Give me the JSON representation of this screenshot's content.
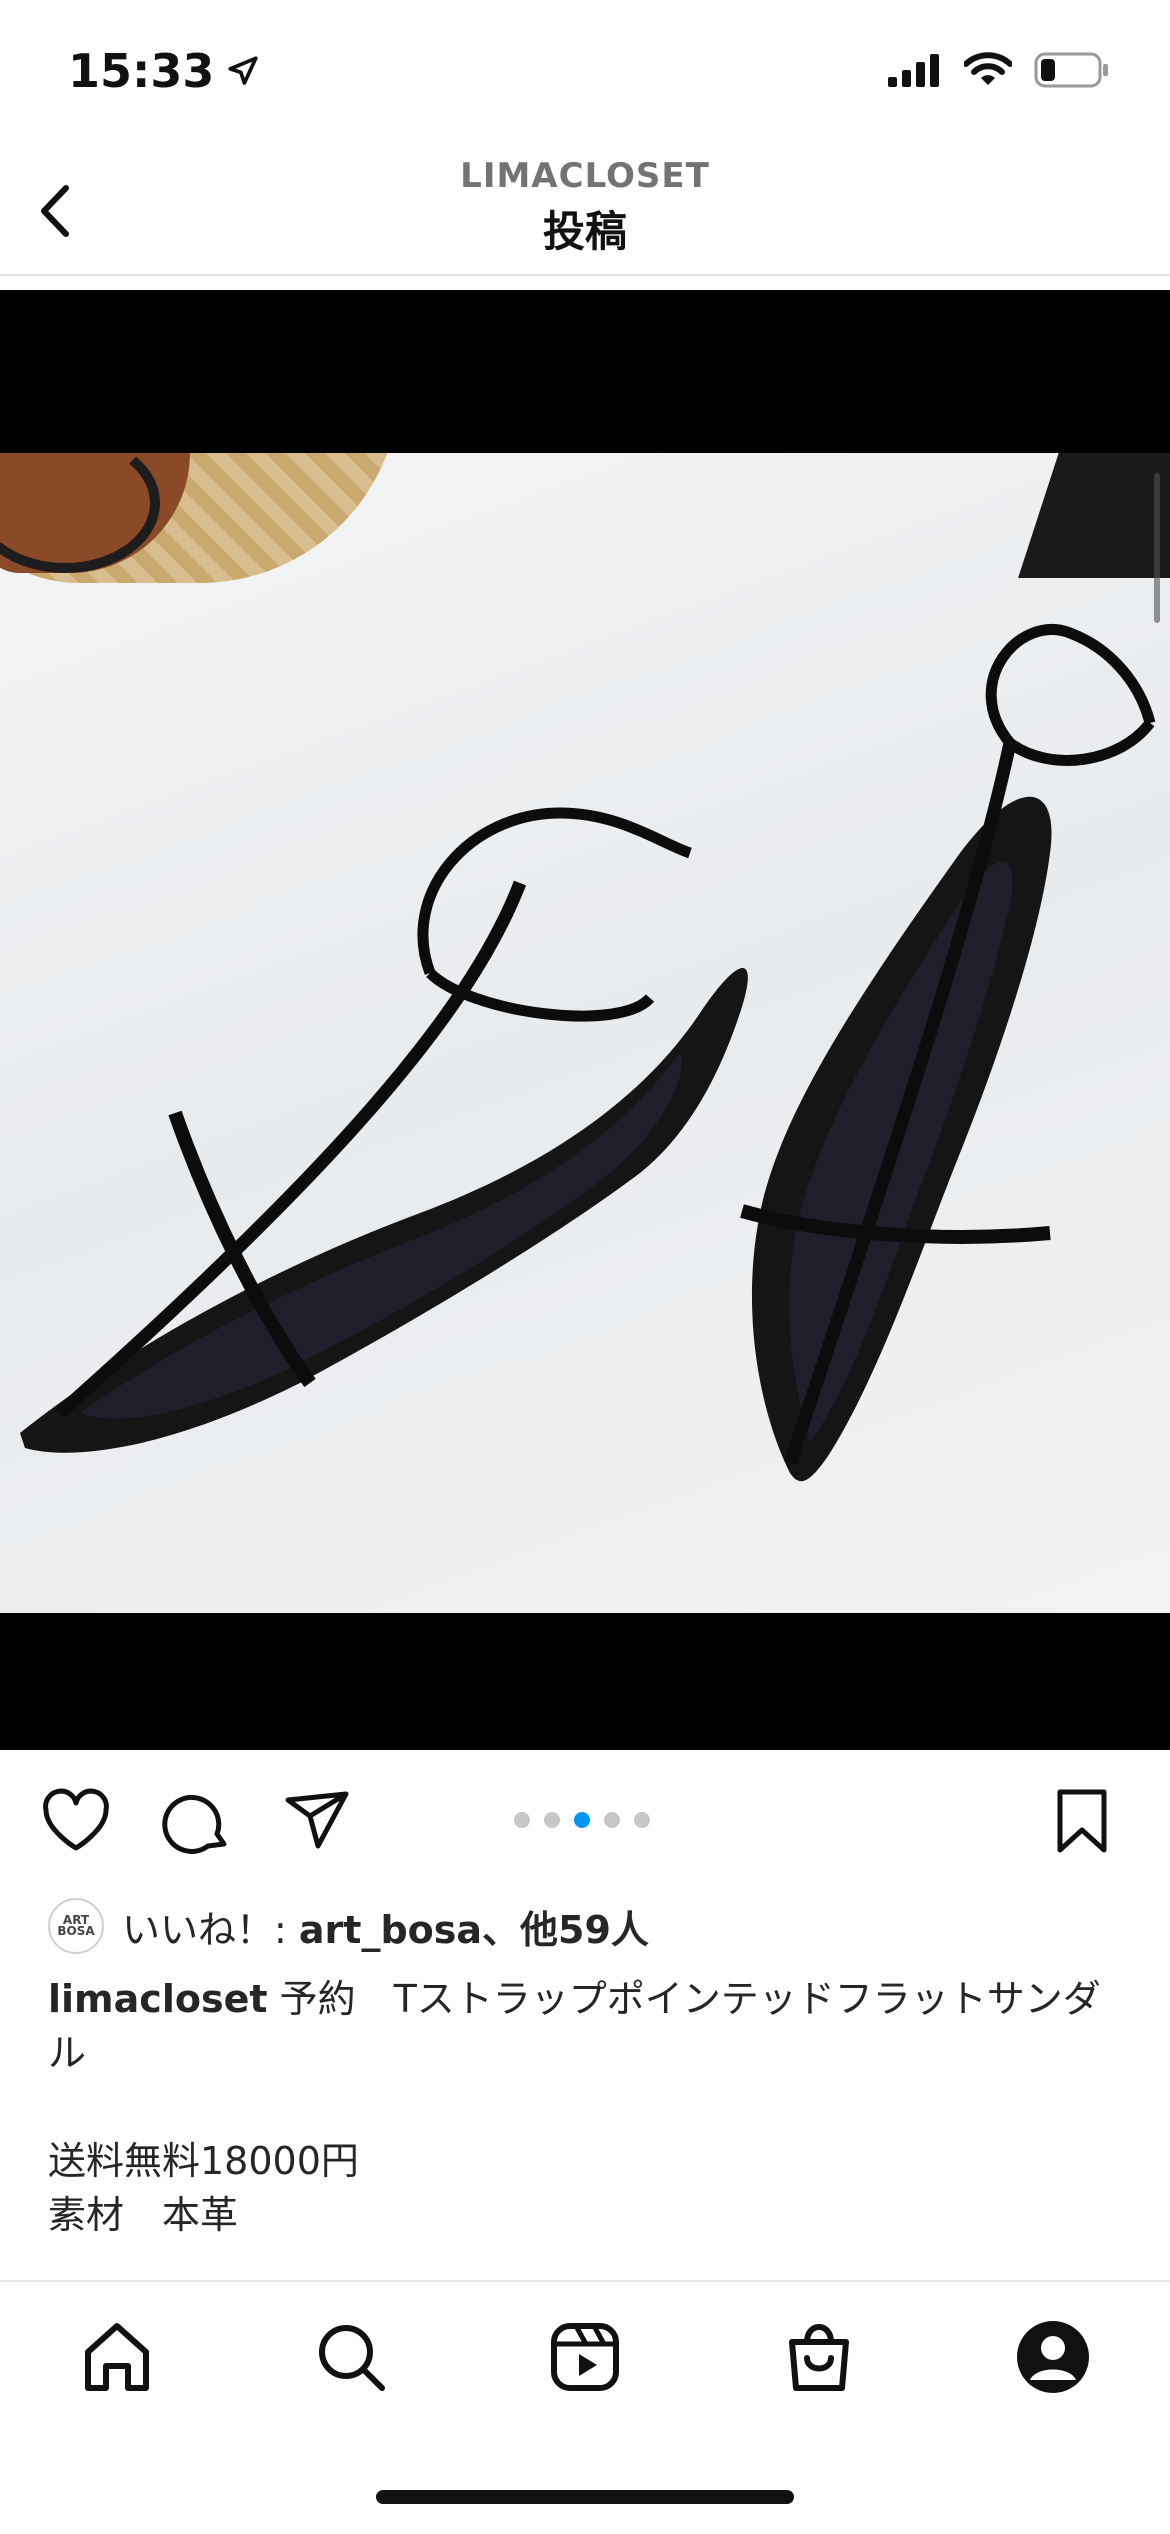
{
  "status": {
    "time": "15:33"
  },
  "nav": {
    "account": "LIMACLOSET",
    "title": "投稿"
  },
  "media": {
    "dot_count": 5,
    "active_dot": 2
  },
  "likes": {
    "prefix": "いいね！: ",
    "user": "art_bosa",
    "suffix": "、他59人",
    "avatar_text": "ART BOSA"
  },
  "caption": {
    "username": "limacloset",
    "line1": " 予約　Tストラップポインテッドフラットサンダル",
    "line2": "送料無料18000円",
    "line3": "素材　本革"
  },
  "colors": {
    "accent": "#0095f6",
    "text": "#262626",
    "muted": "#737373"
  },
  "icons": {
    "actions": [
      "heart-icon",
      "comment-icon",
      "share-icon",
      "bookmark-icon"
    ],
    "tabs": [
      "home-icon",
      "search-icon",
      "reels-icon",
      "shop-icon",
      "profile-icon"
    ]
  }
}
